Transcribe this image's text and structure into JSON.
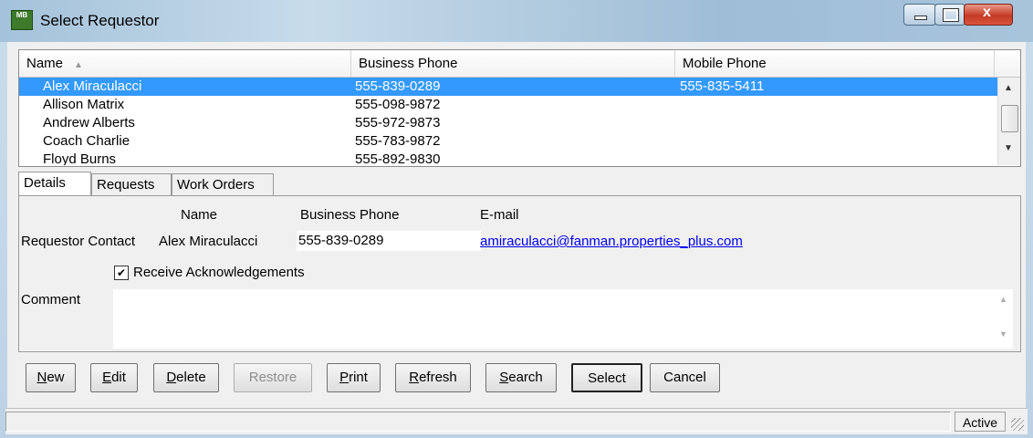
{
  "window": {
    "title": "Select Requestor",
    "icon_label": "MB"
  },
  "list": {
    "columns": [
      "Name",
      "Business Phone",
      "Mobile Phone"
    ],
    "rows": [
      {
        "name": "Alex Miraculacci",
        "business": "555-839-0289",
        "mobile": "555-835-5411",
        "selected": true
      },
      {
        "name": "Allison Matrix",
        "business": "555-098-9872",
        "mobile": ""
      },
      {
        "name": "Andrew Alberts",
        "business": "555-972-9873",
        "mobile": ""
      },
      {
        "name": "Coach Charlie",
        "business": "555-783-9872",
        "mobile": ""
      },
      {
        "name": "Floyd Burns",
        "business": "555-892-9830",
        "mobile": ""
      }
    ]
  },
  "tabs": [
    "Details",
    "Requests",
    "Work Orders"
  ],
  "details": {
    "name_header": "Name",
    "business_header": "Business Phone",
    "email_header": "E-mail",
    "row_label": "Requestor Contact",
    "name_value": "Alex Miraculacci",
    "business_value": "555-839-0289",
    "email_value": "amiraculacci@fanman.properties_plus.com",
    "checkbox_label": "Receive Acknowledgements",
    "checkbox_checked": true,
    "comment_label": "Comment",
    "comment_value": ""
  },
  "buttons": [
    {
      "label": "New",
      "mnemonic": "N"
    },
    {
      "label": "Edit",
      "mnemonic": "E"
    },
    {
      "label": "Delete",
      "mnemonic": "D"
    },
    {
      "label": "Restore",
      "disabled": true
    },
    {
      "label": "Print",
      "mnemonic": "P"
    },
    {
      "label": "Refresh",
      "mnemonic": "R"
    },
    {
      "label": "Search",
      "mnemonic": "S"
    },
    {
      "label": "Select",
      "default": true
    },
    {
      "label": "Cancel"
    }
  ],
  "status": {
    "state": "Active"
  },
  "colors": {
    "selection": "#3399ff",
    "link": "#0000ee"
  }
}
